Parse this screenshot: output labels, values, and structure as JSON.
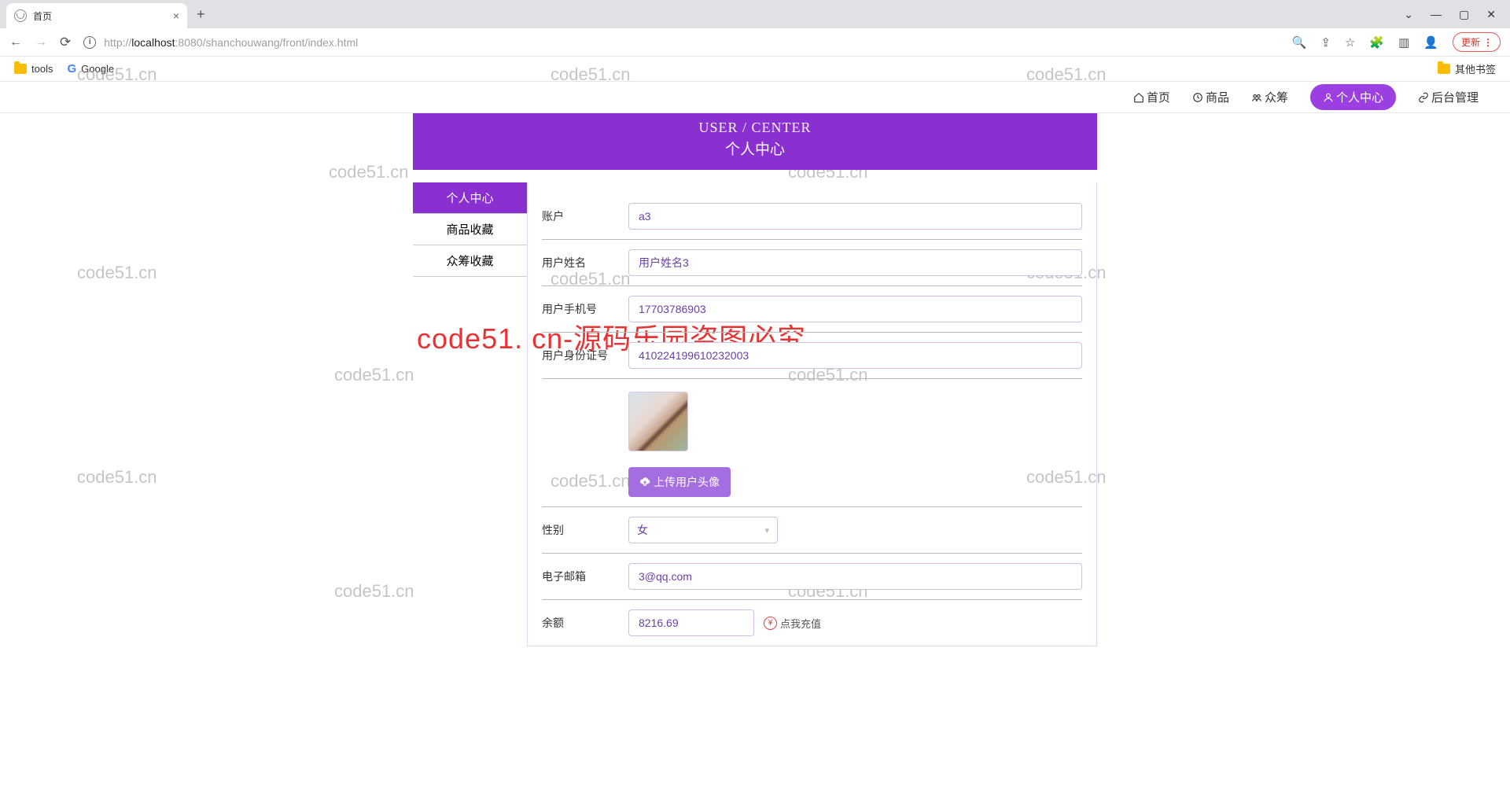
{
  "browser": {
    "tab_title": "首页",
    "url_prefix": "http://",
    "url_host": "localhost",
    "url_port_path": ":8080/shanchouwang/front/index.html",
    "update_label": "更新",
    "bookmarks": {
      "tools": "tools",
      "google": "Google",
      "other": "其他书签"
    }
  },
  "nav": {
    "home": "首页",
    "goods": "商品",
    "crowd": "众筹",
    "user": "个人中心",
    "admin": "后台管理"
  },
  "hero": {
    "en": "USER / CENTER",
    "cn": "个人中心"
  },
  "side": {
    "user_center": "个人中心",
    "goods_fav": "商品收藏",
    "crowd_fav": "众筹收藏"
  },
  "form": {
    "account": {
      "label": "账户",
      "value": "a3"
    },
    "name": {
      "label": "用户姓名",
      "value": "用户姓名3"
    },
    "phone": {
      "label": "用户手机号",
      "value": "17703786903"
    },
    "idcard": {
      "label": "用户身份证号",
      "value": "410224199610232003"
    },
    "upload_btn": "上传用户头像",
    "gender": {
      "label": "性别",
      "value": "女"
    },
    "email": {
      "label": "电子邮箱",
      "value": "3@qq.com"
    },
    "balance": {
      "label": "余额",
      "value": "8216.69",
      "recharge": "点我充值"
    }
  },
  "watermark": "code51.cn",
  "watermark_red": "code51. cn-源码乐园盗图必究"
}
